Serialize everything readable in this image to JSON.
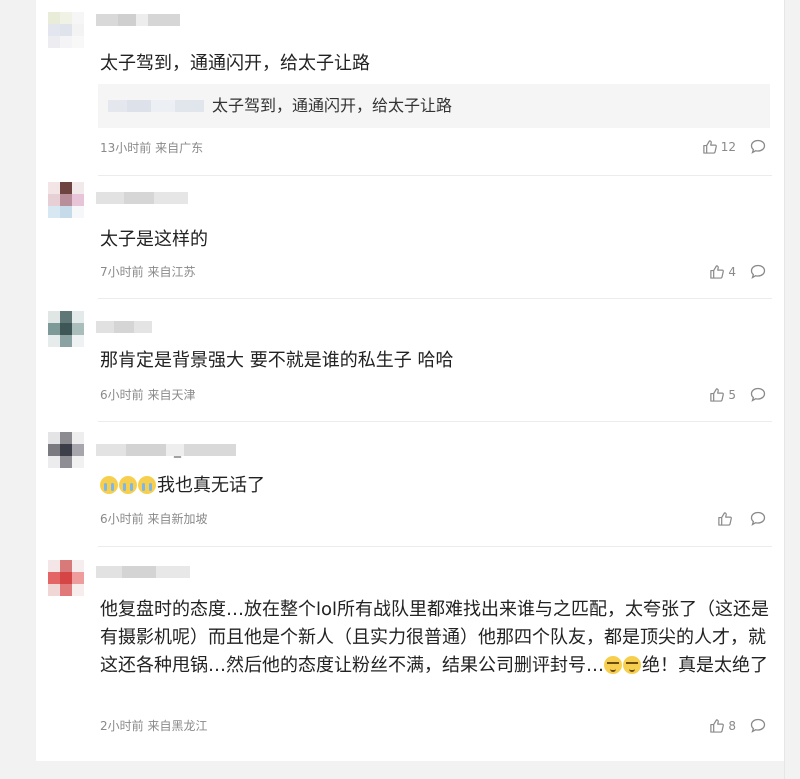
{
  "comments": [
    {
      "text": "太子驾到，通通闪开，给太子让路",
      "quote_text": "太子驾到，通通闪开，给太子让路",
      "time": "13小时前",
      "location": "来自广东",
      "likes": "12"
    },
    {
      "text": "太子是这样的",
      "time": "7小时前",
      "location": "来自江苏",
      "likes": "4"
    },
    {
      "text": "那肯定是背景强大 要不就是谁的私生子 哈哈",
      "time": "6小时前",
      "location": "来自天津",
      "likes": "5"
    },
    {
      "text": "我也真无话了",
      "time": "6小时前",
      "location": "来自新加坡",
      "likes": "",
      "username_separator": "_"
    },
    {
      "text_before_emoji": "他复盘时的态度…放在整个lol所有战队里都难找出来谁与之匹配，太夸张了（这还是有摄影机呢）而且他是个新人（且实力很普通）他那四个队友，都是顶尖的人才，就这还各种甩锅…然后他的态度让粉丝不满，结果公司删评封号…",
      "text_after_emoji": "绝！真是太绝了",
      "time": "2小时前",
      "location": "来自黑龙江",
      "likes": "8"
    }
  ],
  "icons": {
    "like": "thumbs-up-icon",
    "reply": "comment-bubble-icon",
    "emoji_cry": "crying-face-emoji",
    "emoji_smug": "smug-face-emoji"
  },
  "colors": {
    "text": "#222222",
    "meta": "#8a8a8a",
    "quote_bg": "#f5f5f5",
    "divider": "#ececec"
  }
}
